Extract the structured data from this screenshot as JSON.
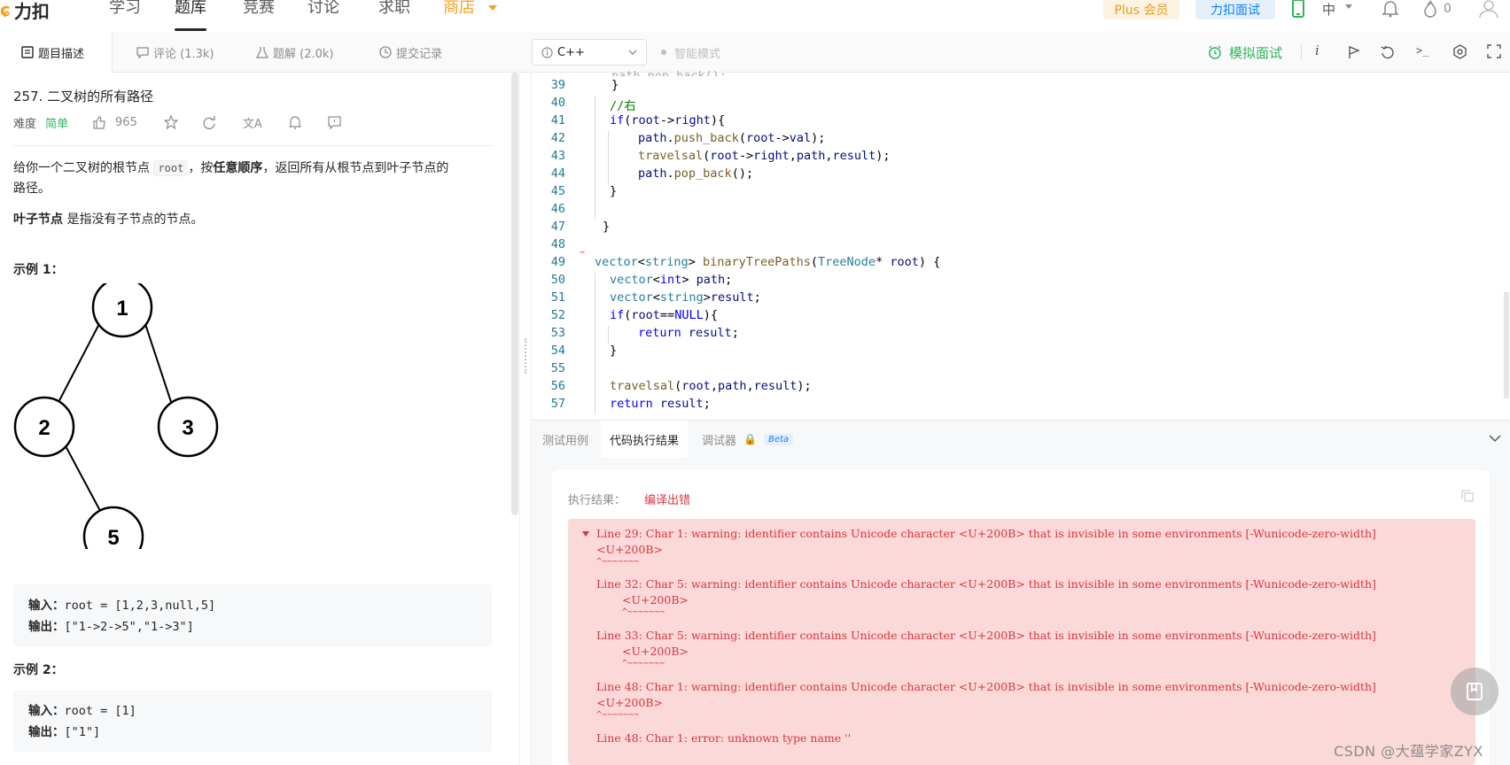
{
  "topnav": {
    "logo_text": "力扣",
    "items": [
      "学习",
      "题库",
      "竞赛",
      "讨论",
      "求职",
      "商店"
    ],
    "plus_label": "Plus 会员",
    "interview_label": "力扣面试",
    "lang_label": "中",
    "fire_count": "0"
  },
  "subbar": {
    "tabs": [
      "题目描述",
      "评论 (1.3k)",
      "题解 (2.0k)",
      "提交记录"
    ],
    "language": "C++",
    "smart_mode": "智能模式",
    "mock_interview": "模拟面试"
  },
  "problem": {
    "title": "257. 二叉树的所有路径",
    "difficulty_label": "难度",
    "difficulty": "简单",
    "likes": "965",
    "desc_1": "给你一个二叉树的根节点",
    "desc_root": "root",
    "desc_2": "，按",
    "desc_bold": "任意顺序",
    "desc_3": "，返回所有从根节点到叶子节点的",
    "desc_4": "路径。",
    "leaf_bold": "叶子节点",
    "leaf_text": "是指没有子节点的节点。",
    "example1_title": "示例 1：",
    "tree_nodes": [
      "1",
      "2",
      "3",
      "5"
    ],
    "ex1_in_label": "输入：",
    "ex1_in": "root = [1,2,3,null,5]",
    "ex1_out_label": "输出：",
    "ex1_out": "[\"1->2->5\",\"1->3\"]",
    "example2_title": "示例 2：",
    "ex2_in_label": "输入：",
    "ex2_in": "root = [1]",
    "ex2_out_label": "输出：",
    "ex2_out": "[\"1\"]"
  },
  "editor": {
    "line_numbers": [
      "39",
      "40",
      "41",
      "42",
      "43",
      "44",
      "45",
      "46",
      "47",
      "48",
      "49",
      "50",
      "51",
      "52",
      "53",
      "54",
      "55",
      "56",
      "57"
    ]
  },
  "bottom": {
    "tabs": [
      "测试用例",
      "代码执行结果",
      "调试器"
    ],
    "beta": "Beta",
    "result_label": "执行结果：",
    "result_value": "编译出错",
    "errors": [
      "Line 29: Char 1: warning: identifier contains Unicode character <U+200B> that is invisible in some environments [-Wunicode-zero-width]",
      "<U+200B>",
      "Line 32: Char 5: warning: identifier contains Unicode character <U+200B> that is invisible in some environments [-Wunicode-zero-width]",
      "<U+200B>",
      "Line 33: Char 5: warning: identifier contains Unicode character <U+200B> that is invisible in some environments [-Wunicode-zero-width]",
      "<U+200B>",
      "Line 48: Char 1: warning: identifier contains Unicode character <U+200B> that is invisible in some environments [-Wunicode-zero-width]",
      "<U+200B>",
      "Line 48: Char 1: error: unknown type name ''"
    ],
    "squiggle": "^~~~~~~~"
  },
  "watermark": "CSDN @大蕴学家ZYX"
}
